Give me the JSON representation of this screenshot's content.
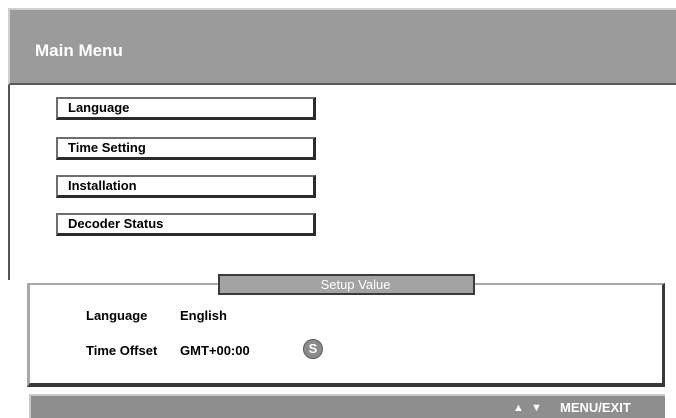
{
  "header": {
    "title": "Main Menu"
  },
  "menu": {
    "items": [
      {
        "label": "Language"
      },
      {
        "label": "Time Setting"
      },
      {
        "label": "Installation"
      },
      {
        "label": "Decoder Status"
      }
    ]
  },
  "setup": {
    "header": "Setup Value",
    "rows": [
      {
        "label": "Language",
        "value": "English"
      },
      {
        "label": "Time Offset",
        "value": "GMT+00:00",
        "badge": "S"
      }
    ]
  },
  "footer": {
    "arrows": "▲ ▼",
    "label": "MENU/EXIT"
  },
  "colors": {
    "bar": "#9b9b9b",
    "footer": "#8e8e8e",
    "border_dark": "#2b2b2b"
  }
}
